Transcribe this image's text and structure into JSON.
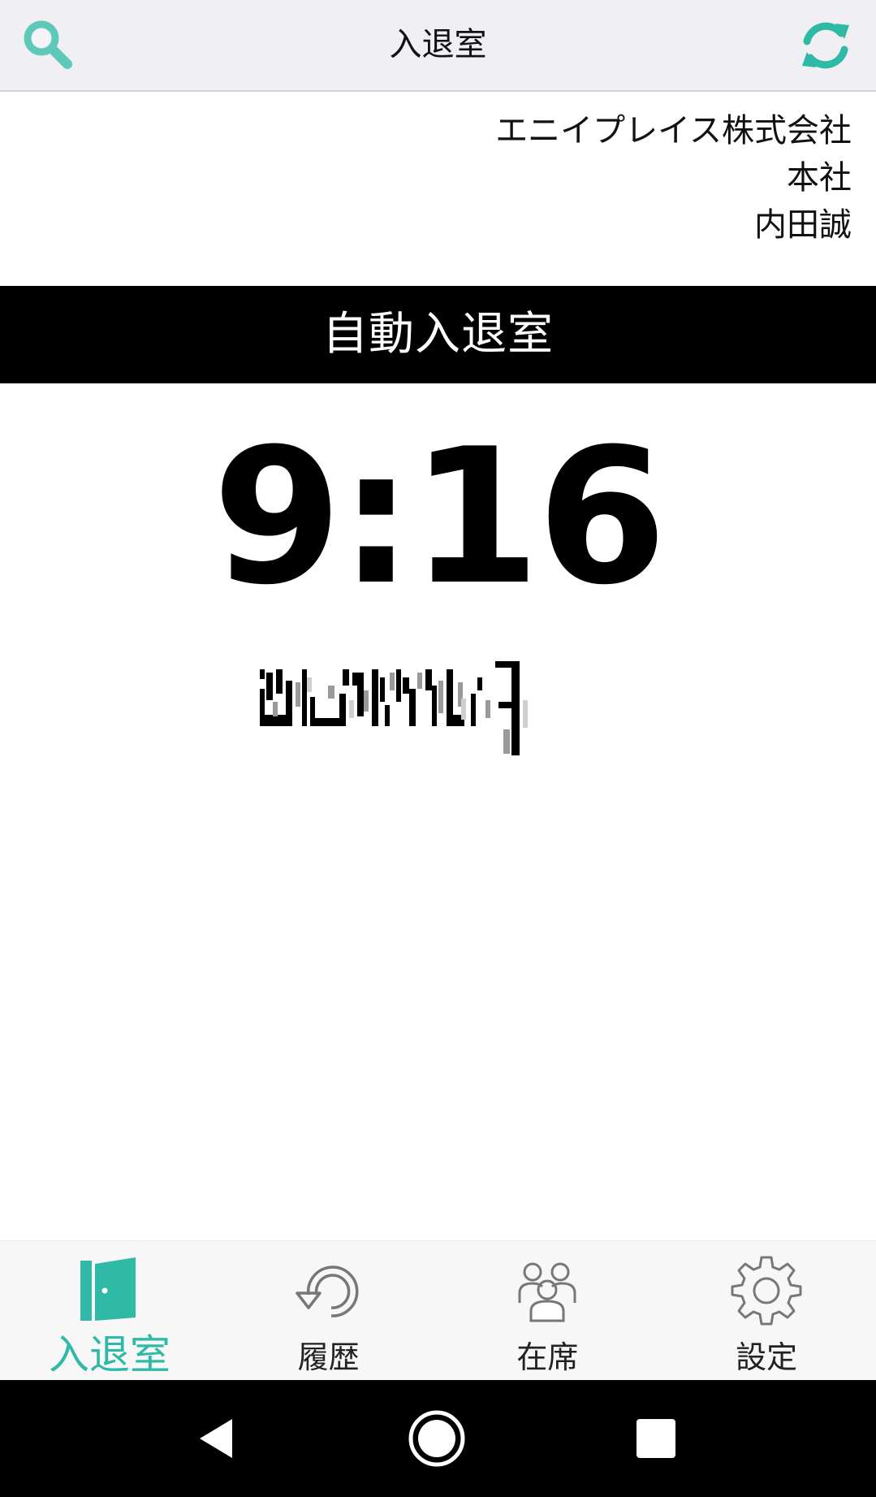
{
  "header": {
    "title": "入退室",
    "search_icon": "search-icon",
    "refresh_icon": "refresh-icon"
  },
  "user": {
    "company": "エニイプレイス株式会社",
    "office": "本社",
    "name": "内田誠"
  },
  "banner": {
    "label": "自動入退室"
  },
  "clock": {
    "time": "9:16"
  },
  "tabs": [
    {
      "label": "入退室",
      "icon": "door-icon",
      "active": true
    },
    {
      "label": "履歴",
      "icon": "history-icon",
      "active": false
    },
    {
      "label": "在席",
      "icon": "people-icon",
      "active": false
    },
    {
      "label": "設定",
      "icon": "gear-icon",
      "active": false
    }
  ],
  "colors": {
    "accent": "#2ebaa6",
    "header_bg": "#efeff4",
    "banner_bg": "#000000"
  },
  "system_nav": [
    "back-icon",
    "home-icon",
    "recents-icon"
  ]
}
